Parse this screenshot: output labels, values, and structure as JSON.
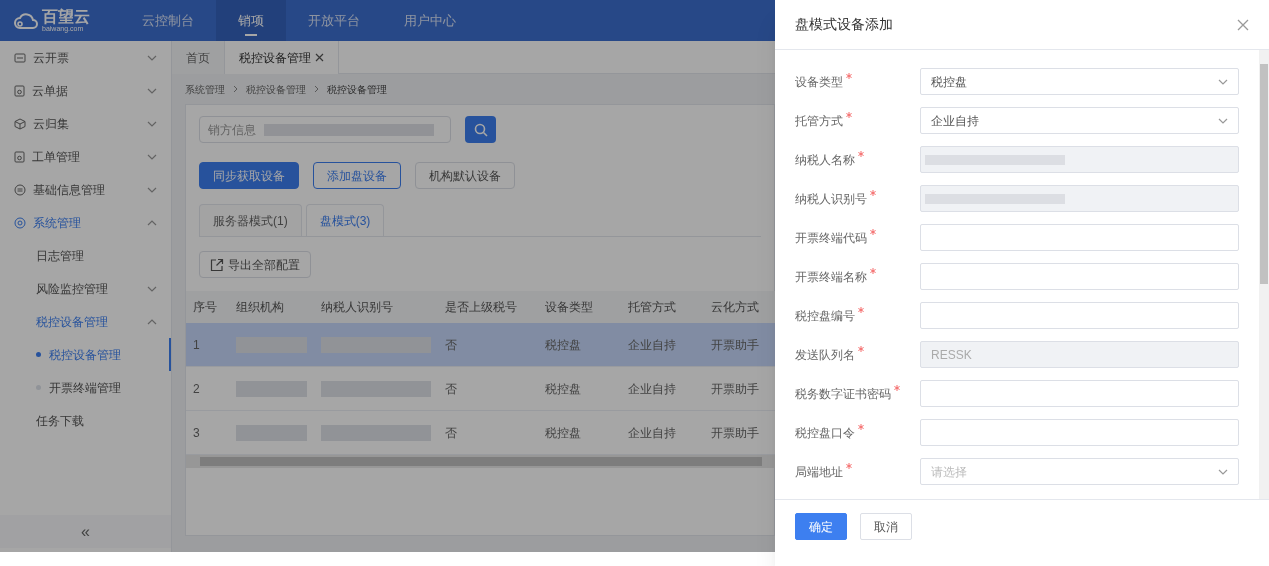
{
  "topbar": {
    "logo": "百望云",
    "logo_sub": "baiwang.com",
    "nav": [
      {
        "label": "云控制台",
        "selected": false
      },
      {
        "label": "销项",
        "selected": true
      },
      {
        "label": "开放平台",
        "selected": false
      },
      {
        "label": "用户中心",
        "selected": false
      }
    ]
  },
  "sidebar": {
    "items": [
      {
        "label": "云开票",
        "expanded": false
      },
      {
        "label": "云单据",
        "expanded": false
      },
      {
        "label": "云归集",
        "expanded": false
      },
      {
        "label": "工单管理",
        "expanded": false
      },
      {
        "label": "基础信息管理",
        "expanded": false
      },
      {
        "label": "系统管理",
        "expanded": true,
        "children": [
          {
            "label": "日志管理"
          },
          {
            "label": "风险监控管理",
            "expanded": false
          },
          {
            "label": "税控设备管理",
            "expanded": true,
            "children": [
              {
                "label": "税控设备管理",
                "selected": true
              },
              {
                "label": "开票终端管理",
                "selected": false
              }
            ]
          },
          {
            "label": "任务下载"
          }
        ]
      }
    ],
    "collapse": "«"
  },
  "page_tabs": [
    {
      "label": "首页",
      "selected": false,
      "closable": false
    },
    {
      "label": "税控设备管理",
      "selected": true,
      "closable": true
    }
  ],
  "breadcrumb": [
    "系统管理",
    "税控设备管理",
    "税控设备管理"
  ],
  "search": {
    "label": "销方信息"
  },
  "actions": [
    {
      "label": "同步获取设备",
      "kind": "primary"
    },
    {
      "label": "添加盘设备",
      "kind": "outline"
    },
    {
      "label": "机构默认设备",
      "kind": "plain"
    }
  ],
  "mode_tabs": [
    {
      "label": "服务器模式(1)",
      "selected": false
    },
    {
      "label": "盘模式(3)",
      "selected": true
    }
  ],
  "export_button": "导出全部配置",
  "table": {
    "columns": [
      "序号",
      "组织机构",
      "纳税人识别号",
      "是否上级税号",
      "设备类型",
      "托管方式",
      "云化方式"
    ],
    "rows": [
      {
        "selected": true,
        "cells": [
          "1",
          null,
          null,
          "否",
          "税控盘",
          "企业自持",
          "开票助手"
        ]
      },
      {
        "selected": false,
        "cells": [
          "2",
          null,
          null,
          "否",
          "税控盘",
          "企业自持",
          "开票助手"
        ]
      },
      {
        "selected": false,
        "cells": [
          "3",
          null,
          null,
          "否",
          "税控盘",
          "企业自持",
          "开票助手"
        ]
      }
    ]
  },
  "drawer": {
    "title": "盘模式设备添加",
    "fields": [
      {
        "label": "设备类型",
        "required": true,
        "kind": "select",
        "value": "税控盘"
      },
      {
        "label": "托管方式",
        "required": true,
        "kind": "select",
        "value": "企业自持"
      },
      {
        "label": "纳税人名称",
        "required": true,
        "kind": "redacted"
      },
      {
        "label": "纳税人识别号",
        "required": true,
        "kind": "redacted"
      },
      {
        "label": "开票终端代码",
        "required": true,
        "kind": "input"
      },
      {
        "label": "开票终端名称",
        "required": true,
        "kind": "input"
      },
      {
        "label": "税控盘编号",
        "required": true,
        "kind": "input"
      },
      {
        "label": "发送队列名",
        "required": true,
        "kind": "disabled",
        "value": "RESSK"
      },
      {
        "label": "税务数字证书密码",
        "required": true,
        "kind": "input"
      },
      {
        "label": "税控盘口令",
        "required": true,
        "kind": "input"
      },
      {
        "label": "局端地址",
        "required": true,
        "kind": "select",
        "placeholder": "请选择"
      }
    ],
    "buttons": [
      {
        "label": "确定",
        "kind": "primary"
      },
      {
        "label": "取消",
        "kind": "plain"
      }
    ]
  }
}
